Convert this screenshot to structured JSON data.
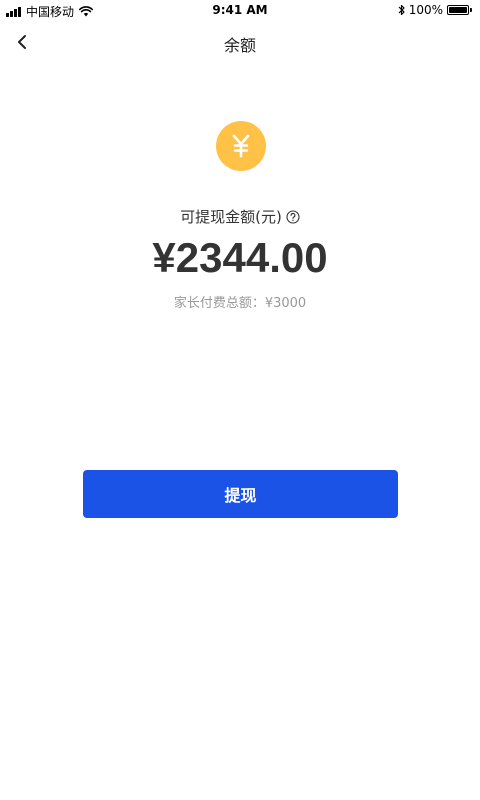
{
  "status_bar": {
    "carrier": "中国移动",
    "time": "9:41 AM",
    "battery_percent": "100%",
    "battery_level": 1.0,
    "signal_icon": "signal-icon",
    "wifi_icon": "wifi-icon",
    "bluetooth_icon": "bluetooth-icon",
    "battery_icon": "battery-icon"
  },
  "nav": {
    "title": "余额",
    "back_icon": "chevron-left-icon"
  },
  "balance": {
    "icon": "yuan-coin-icon",
    "icon_symbol": "¥",
    "icon_color": "#FFC247",
    "label": "可提现金额(元)",
    "help_icon": "question-circle-icon",
    "amount": "¥2344.00",
    "parent_total": "家长付费总额：¥3000"
  },
  "actions": {
    "withdraw_label": "提现",
    "accent_color": "#1A53E6"
  }
}
